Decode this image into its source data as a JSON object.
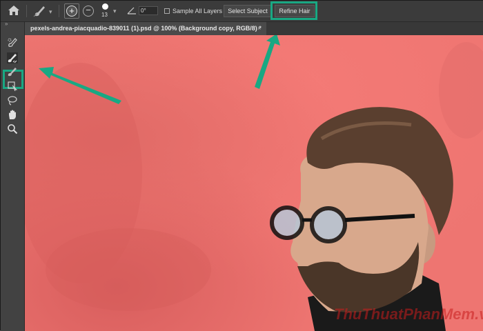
{
  "options_bar": {
    "brush_size": "13",
    "angle_value": "0°",
    "sample_all_layers_label": "Sample All Layers",
    "sample_all_layers_checked": false,
    "select_subject_label": "Select Subject",
    "refine_hair_label": "Refine Hair"
  },
  "document_tab": {
    "title": "pexels-andrea-piacquadio-839011 (1).psd @ 100% (Background copy, RGB/8) *",
    "close_glyph": "×"
  },
  "tools_panel": {
    "collapse_glyph": "»",
    "tools": [
      "quick-selection-icon",
      "refine-edge-brush-icon",
      "brush-icon",
      "object-selection-icon",
      "lasso-icon",
      "hand-icon",
      "zoom-icon"
    ],
    "active_tool": "refine-edge-brush-icon"
  },
  "annotations": {
    "highlight_color": "#19a883"
  },
  "canvas": {
    "overlay_color": "#ee7571",
    "watermark": "ThuThuatPhanMem.vn"
  }
}
